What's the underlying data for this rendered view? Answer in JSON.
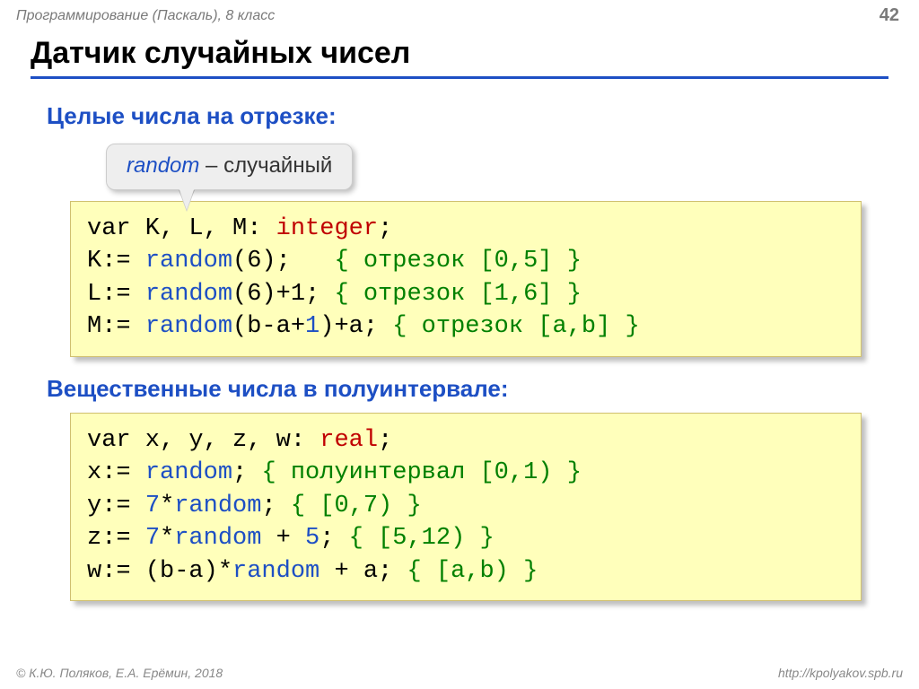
{
  "header": {
    "course": "Программирование (Паскаль), 8 класс",
    "page": "42"
  },
  "title": "Датчик случайных чисел",
  "subtitle1": "Целые числа на отрезке:",
  "subtitle2": "Вещественные числа в полуинтервале:",
  "callout": {
    "keyword": "random",
    "dash": " – ",
    "meaning": "случайный"
  },
  "code1": {
    "l1_var": "var",
    "l1_decl": " K, L, M: ",
    "l1_type": "integer",
    "l1_end": ";",
    "l2_lhs": "K:= ",
    "l2_fn": "random",
    "l2_args": "(6);   ",
    "l2_cmt": "{ отрезок [0,5] }",
    "l3_lhs": "L:= ",
    "l3_fn": "random",
    "l3_args": "(6)+1; ",
    "l3_cmt": "{ отрезок [1,6] }",
    "l4_lhs": "M:= ",
    "l4_fn": "random",
    "l4_args": "(b-a+",
    "l4_one": "1",
    "l4_rest": ")+a; ",
    "l4_cmt": "{ отрезок [a,b] }"
  },
  "code2": {
    "l1_var": "var",
    "l1_decl": " x, y, z, w: ",
    "l1_type": "real",
    "l1_end": ";",
    "l2_lhs": "x:= ",
    "l2_fn": "random",
    "l2_rest": "; ",
    "l2_cmt": "{ полуинтервал [0,1) }",
    "l3_lhs": "y:= ",
    "l3_seven": "7",
    "l3_star": "*",
    "l3_fn": "random",
    "l3_rest": "; ",
    "l3_cmt": "{ [0,7) }",
    "l4_lhs": "z:= ",
    "l4_seven": "7",
    "l4_star": "*",
    "l4_fn": "random",
    "l4_plus": " + ",
    "l4_five": "5",
    "l4_rest": "; ",
    "l4_cmt": "{ [5,12) }",
    "l5_lhs": "w:= ",
    "l5_expr1": "(b-a)*",
    "l5_fn": "random",
    "l5_expr2": " + a; ",
    "l5_cmt": "{ [a,b) }"
  },
  "footer": {
    "left": "© К.Ю. Поляков, Е.А. Ерёмин, 2018",
    "right": "http://kpolyakov.spb.ru"
  }
}
